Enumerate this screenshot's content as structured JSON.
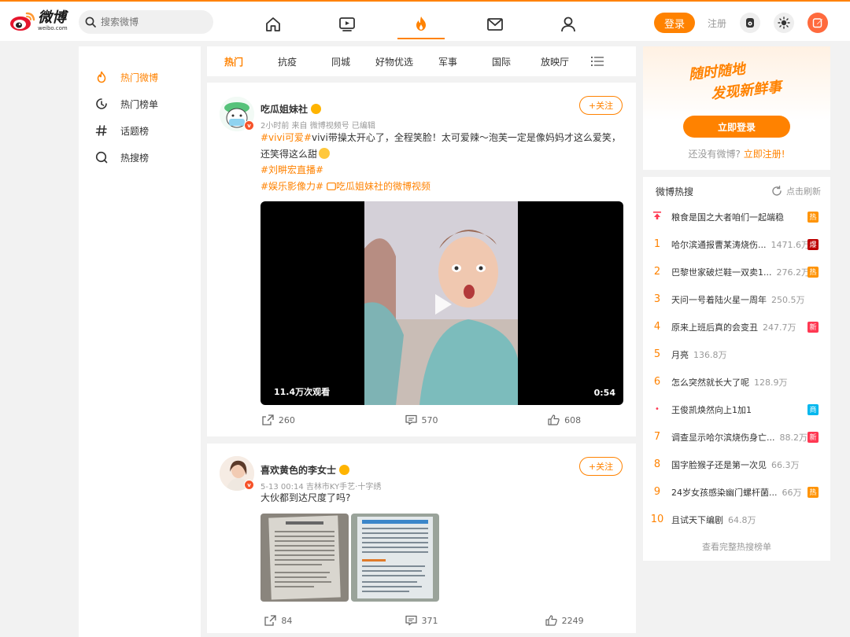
{
  "header": {
    "logo_cn": "微博",
    "logo_en": "weibo.com",
    "search_placeholder": "搜索微博",
    "login_label": "登录",
    "register_label": "注册"
  },
  "left_nav": {
    "items": [
      {
        "label": "热门微博",
        "icon": "flame-icon"
      },
      {
        "label": "热门榜单",
        "icon": "clock-icon"
      },
      {
        "label": "话题榜",
        "icon": "hash-icon"
      },
      {
        "label": "热搜榜",
        "icon": "search-icon"
      }
    ]
  },
  "tabs": [
    "热门",
    "抗疫",
    "同城",
    "好物优选",
    "军事",
    "国际",
    "放映厅"
  ],
  "posts": [
    {
      "author": "吃瓜姐妹社",
      "meta": "2小时前 来自 微博视频号 已编辑",
      "follow": "+关注",
      "text_topic1": "#vivi可爱#",
      "text_main": "vivi带操太开心了，全程笑脸！太可爱辣～泡芙一定是像妈妈才这么爱笑，还笑得这么甜",
      "topic2": "#刘畊宏直播#",
      "topic3": "#娱乐影像力#",
      "topic3_link": "吃瓜姐妹社的微博视频",
      "video_views": "11.4万次观看",
      "video_duration": "0:54",
      "reposts": "260",
      "comments": "570",
      "likes": "608"
    },
    {
      "author": "喜欢黄色的李女士",
      "meta": "5-13 00:14 吉林市KY手艺·十字绣",
      "follow": "+关注",
      "text": "大伙都到达尺度了吗?",
      "reposts": "84",
      "comments": "371",
      "likes": "2249"
    }
  ],
  "login_card": {
    "slogan_line1": "随时随地",
    "slogan_line2": "发现新鲜事",
    "login_now": "立即登录",
    "no_account": "还没有微博?",
    "register_now": "立即注册!"
  },
  "hot_search": {
    "title": "微博热搜",
    "refresh": "点击刷新",
    "footer": "查看完整热搜榜单",
    "items": [
      {
        "rank": "",
        "text": "粮食是国之大者咱们一起端稳",
        "num": "",
        "tag": "热",
        "tag_color": "#ff9406"
      },
      {
        "rank": "1",
        "text": "哈尔滨通报曹某涛烧伤...",
        "num": "1471.6万",
        "tag": "爆",
        "tag_color": "#bd0000"
      },
      {
        "rank": "2",
        "text": "巴黎世家破烂鞋一双卖1...",
        "num": "276.2万",
        "tag": "热",
        "tag_color": "#ff9406"
      },
      {
        "rank": "3",
        "text": "天问一号着陆火星一周年",
        "num": "250.5万",
        "tag": "",
        "tag_color": ""
      },
      {
        "rank": "4",
        "text": "原来上班后真的会变丑",
        "num": "247.7万",
        "tag": "新",
        "tag_color": "#ff3852"
      },
      {
        "rank": "5",
        "text": "月亮",
        "num": "136.8万",
        "tag": "",
        "tag_color": ""
      },
      {
        "rank": "6",
        "text": "怎么突然就长大了呢",
        "num": "128.9万",
        "tag": "",
        "tag_color": ""
      },
      {
        "rank": "•",
        "text": "王俊凯焕然向上1加1",
        "num": "",
        "tag": "商",
        "tag_color": "#00b7ee"
      },
      {
        "rank": "7",
        "text": "调查显示哈尔滨烧伤身亡...",
        "num": "88.2万",
        "tag": "新",
        "tag_color": "#ff3852"
      },
      {
        "rank": "8",
        "text": "国字脸猴子还是第一次见",
        "num": "66.3万",
        "tag": "",
        "tag_color": ""
      },
      {
        "rank": "9",
        "text": "24岁女孩感染幽门螺杆菌...",
        "num": "66万",
        "tag": "热",
        "tag_color": "#ff9406"
      },
      {
        "rank": "10",
        "text": "且试天下编剧",
        "num": "64.8万",
        "tag": "",
        "tag_color": ""
      }
    ]
  },
  "colors": {
    "accent": "#ff8200",
    "background": "#f2f2f2"
  }
}
